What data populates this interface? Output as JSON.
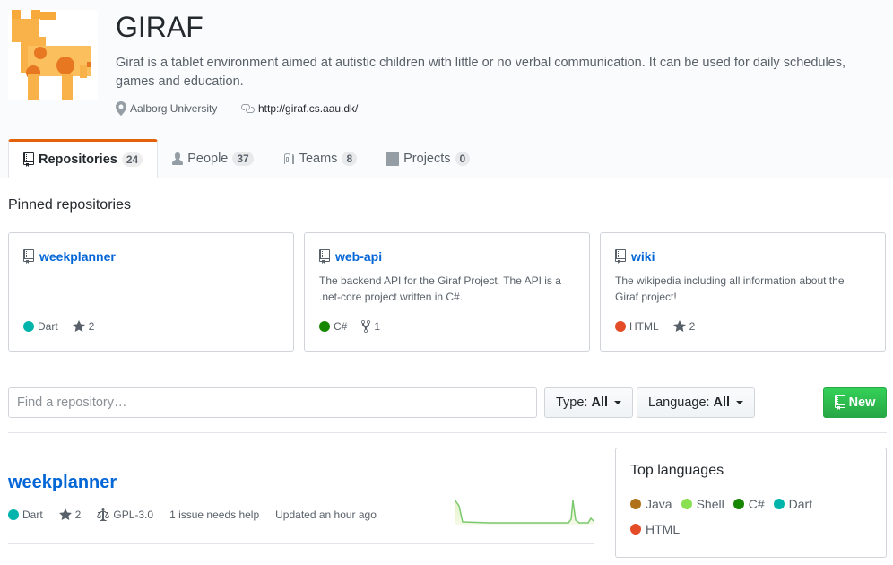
{
  "org": {
    "name": "GIRAF",
    "description": "Giraf is a tablet environment aimed at autistic children with little or no verbal communication. It can be used for daily schedules, games and education.",
    "location": "Aalborg University",
    "url": "http://giraf.cs.aau.dk/"
  },
  "tabs": [
    {
      "label": "Repositories",
      "count": "24",
      "icon": "repo-icon",
      "selected": true
    },
    {
      "label": "People",
      "count": "37",
      "icon": "person-icon",
      "selected": false
    },
    {
      "label": "Teams",
      "count": "8",
      "icon": "jersey-icon",
      "selected": false
    },
    {
      "label": "Projects",
      "count": "0",
      "icon": "project-icon",
      "selected": false
    }
  ],
  "pinned": {
    "title": "Pinned repositories",
    "repos": [
      {
        "name": "weekplanner",
        "description": "",
        "language": "Dart",
        "language_color": "#00b4ab",
        "stat_icon": "star-icon",
        "stat": "2"
      },
      {
        "name": "web-api",
        "description": "The backend API for the Giraf Project. The API is a .net-core project written in C#.",
        "language": "C#",
        "language_color": "#178600",
        "stat_icon": "fork-icon",
        "stat": "1"
      },
      {
        "name": "wiki",
        "description": "The wikipedia including all information about the Giraf project!",
        "language": "HTML",
        "language_color": "#e34c26",
        "stat_icon": "star-icon",
        "stat": "2"
      }
    ]
  },
  "filters": {
    "search_placeholder": "Find a repository…",
    "type_label": "Type:",
    "type_value": "All",
    "language_label": "Language:",
    "language_value": "All",
    "new_label": "New"
  },
  "repo_list": [
    {
      "name": "weekplanner",
      "language": "Dart",
      "language_color": "#00b4ab",
      "stars": "2",
      "license": "GPL-3.0",
      "issues": "1 issue needs help",
      "updated": "Updated an hour ago"
    }
  ],
  "top_languages": {
    "title": "Top languages",
    "items": [
      {
        "name": "Java",
        "color": "#b07219"
      },
      {
        "name": "Shell",
        "color": "#89e051"
      },
      {
        "name": "C#",
        "color": "#178600"
      },
      {
        "name": "Dart",
        "color": "#00b4ab"
      },
      {
        "name": "HTML",
        "color": "#e34c26"
      }
    ]
  },
  "colors": {
    "accent_tab": "#e36209",
    "link": "#0366d6",
    "new_button": "#28a745"
  }
}
